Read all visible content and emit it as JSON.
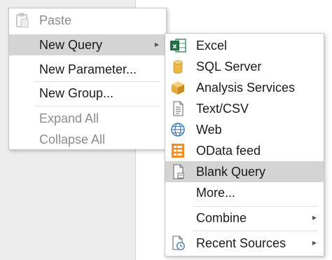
{
  "main_menu": {
    "paste": "Paste",
    "new_query": "New Query",
    "new_parameter": "New Parameter...",
    "new_group": "New Group...",
    "expand_all": "Expand All",
    "collapse_all": "Collapse All"
  },
  "sub_menu": {
    "excel": "Excel",
    "sql_server": "SQL Server",
    "analysis_services": "Analysis Services",
    "text_csv": "Text/CSV",
    "web": "Web",
    "odata_feed": "OData feed",
    "blank_query": "Blank Query",
    "more": "More...",
    "combine": "Combine",
    "recent_sources": "Recent Sources"
  },
  "icons": {
    "paste": "paste-icon",
    "excel": "excel-icon",
    "sql_server": "database-icon",
    "analysis_services": "cube-icon",
    "text_csv": "document-icon",
    "web": "globe-icon",
    "odata_feed": "odata-icon",
    "blank_query": "blank-query-icon",
    "recent_sources": "recent-sources-icon"
  },
  "colors": {
    "highlight": "#d4d4d4",
    "excel_green": "#1e7145",
    "sql_gold": "#e8b84a",
    "cube_gold": "#e3a93a",
    "globe_blue": "#2f6fb3",
    "odata_orange": "#f28c28",
    "disabled_text": "#8c8c8c"
  }
}
